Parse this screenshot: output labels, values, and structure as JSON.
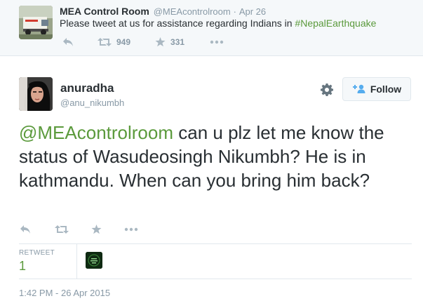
{
  "parent_tweet": {
    "name": "MEA Control Room",
    "screen_name": "@MEAcontrolroom",
    "separator": "·",
    "time": "Apr 26",
    "text_before": "Please tweet at us for assistance regarding Indians in ",
    "hashtag": "#NepalEarthquake",
    "retweet_count": "949",
    "favorite_count": "331"
  },
  "tweet": {
    "name": "anuradha",
    "screen_name": "@anu_nikumbh",
    "mention": "@MEAcontrolroom",
    "text": " can u plz let me know the status of Wasudeosingh Nikumbh? He is in kathmandu. When can you bring him back?",
    "follow_label": "Follow",
    "retweet_label": "RETWEET",
    "retweet_count": "1",
    "timestamp": "1:42 PM - 26 Apr 2015"
  },
  "icons": {
    "reply": "reply-icon",
    "retweet": "retweet-icon",
    "favorite": "star-icon",
    "more": "more-icon",
    "settings": "gear-icon",
    "follow": "follow-person-plus-icon"
  },
  "colors": {
    "link_green": "#5b9a3c",
    "muted": "#8899a6",
    "icon_gray": "#aab8c2",
    "follow_blue": "#55acee"
  }
}
